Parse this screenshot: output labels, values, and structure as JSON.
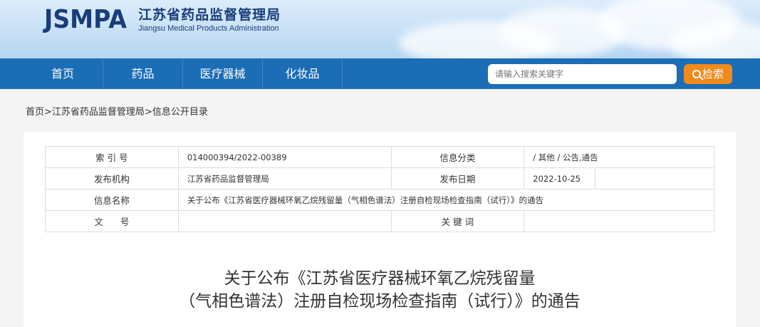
{
  "header": {
    "logo_abbr": "JSMPA",
    "org_cn": "江苏省药品监督管理局",
    "org_en": "Jiangsu Medical Products Administration"
  },
  "nav": {
    "items": [
      "首页",
      "药品",
      "医疗器械",
      "化妆品"
    ],
    "search_placeholder": "请输入搜索关键字",
    "search_button": "检索"
  },
  "breadcrumb": {
    "home": "首页",
    "sep": ">",
    "org": "江苏省药品监督管理局",
    "current": "信息公开目录"
  },
  "info": {
    "index_label": "索 引 号",
    "index_value": "014000394/2022-00389",
    "category_label": "信息分类",
    "category_value": "/  其他  /  公告,通告",
    "publisher_label": "发布机构",
    "publisher_value": "江苏省药品监督管理局",
    "date_label": "发布日期",
    "date_value": "2022-10-25",
    "name_label": "信息名称",
    "name_value": "关于公布《江苏省医疗器械环氧乙烷残留量（气相色谱法）注册自检现场检查指南（试行）》的通告",
    "docno_label": "文      号",
    "docno_value": "",
    "keywords_label": "关 键 词",
    "keywords_value": ""
  },
  "article": {
    "title_line1": "关于公布《江苏省医疗器械环氧乙烷残留量",
    "title_line2": "（气相色谱法）注册自检现场检查指南（试行）》的通告"
  }
}
